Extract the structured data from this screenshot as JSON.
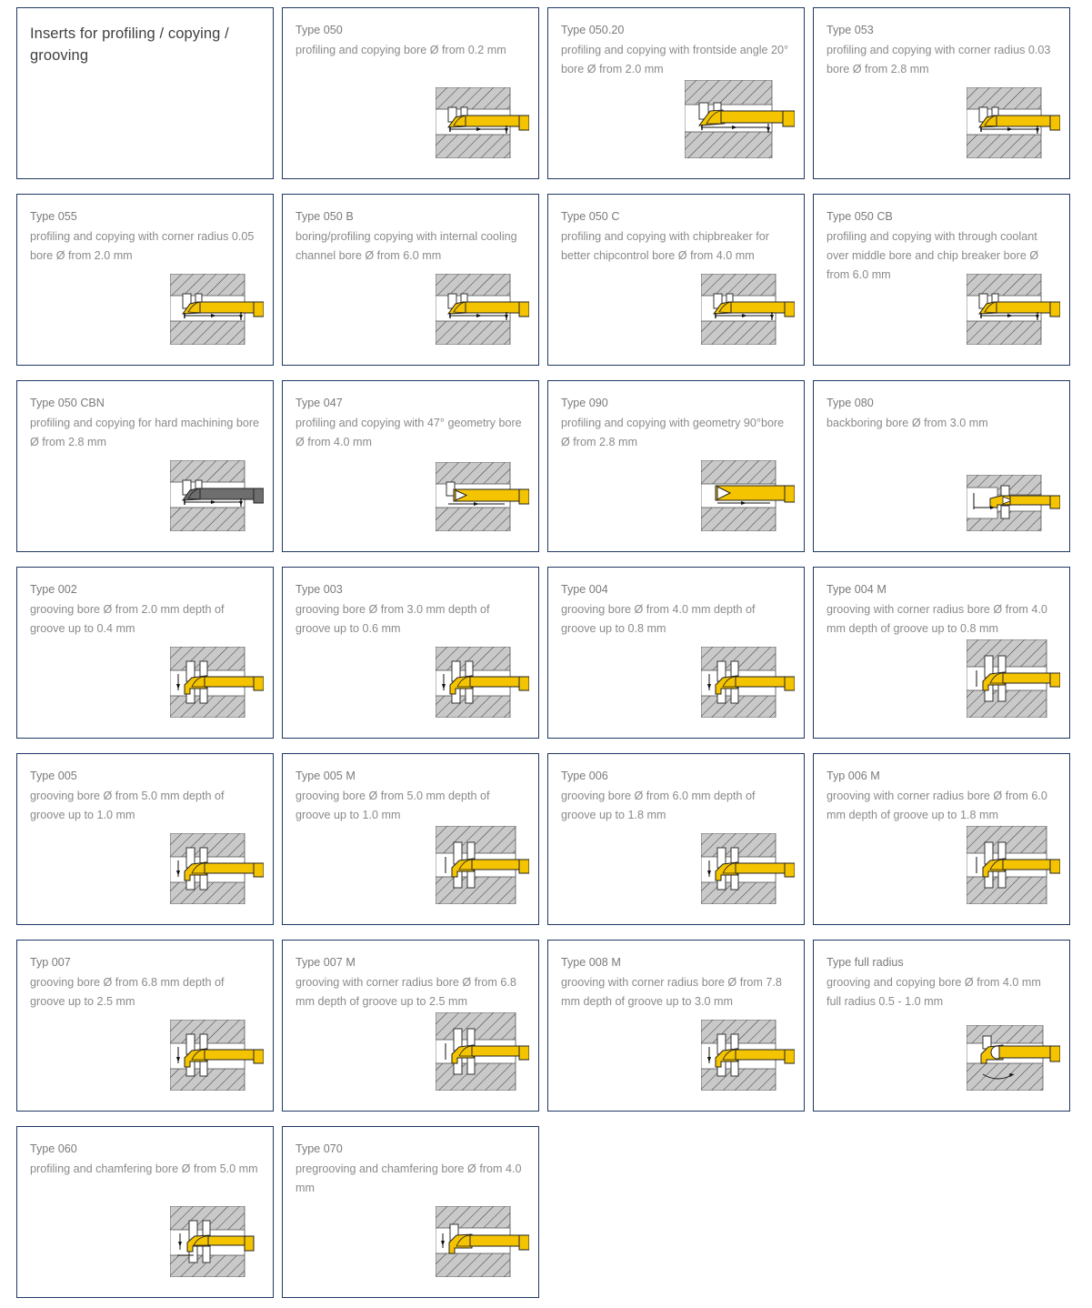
{
  "page": {
    "heading": "Inserts for profiling / copying / grooving",
    "border_color": "#1f3864",
    "text_color": "#808080",
    "tool_color": "#f5c400",
    "tool_color_cbn": "#6e6e6e",
    "material_color": "#c8c8c8"
  },
  "cards": [
    {
      "type": "Type 050",
      "description": "profiling and copying bore Ø from 0.2 mm",
      "figure": "boring-bar-straight"
    },
    {
      "type": "Type 050.20",
      "description": "profiling and copying with frontside angle 20° bore Ø from 2.0 mm",
      "figure": "boring-bar-angled"
    },
    {
      "type": "Type 053",
      "description": "profiling and copying with corner radius 0.03 bore Ø from 2.8 mm",
      "figure": "boring-bar-straight"
    },
    {
      "type": "Type 055",
      "description": "profiling and copying with corner radius 0.05 bore Ø from 2.0 mm",
      "figure": "boring-bar-straight"
    },
    {
      "type": "Type 050 B",
      "description": "boring/profiling copying with internal cooling channel bore Ø from 6.0 mm",
      "figure": "boring-bar-straight"
    },
    {
      "type": "Type 050 C",
      "description": "profiling and copying with chipbreaker for better chipcontrol bore Ø from 4.0 mm",
      "figure": "boring-bar-straight"
    },
    {
      "type": "Type 050 CB",
      "description": "profiling and copying with through coolant over middle bore and chip breaker bore Ø from 6.0 mm",
      "figure": "boring-bar-straight"
    },
    {
      "type": "Type 050 CBN",
      "description": "profiling and copying for hard machining bore Ø from 2.8 mm",
      "figure": "boring-bar-cbn"
    },
    {
      "type": "Type 047",
      "description": "profiling and copying with 47° geometry bore Ø from 4.0 mm",
      "figure": "boring-bar-47"
    },
    {
      "type": "Type 090",
      "description": "profiling and copying with geometry 90°bore Ø from 2.8 mm",
      "figure": "boring-bar-90"
    },
    {
      "type": "Type 080",
      "description": "backboring bore Ø from 3.0 mm",
      "figure": "backboring-bar"
    },
    {
      "type": "Type 002",
      "description": "grooving bore Ø from 2.0 mm depth of groove up to 0.4 mm",
      "figure": "grooving-bar"
    },
    {
      "type": "Type 003",
      "description": "grooving bore Ø from 3.0 mm depth of groove up to 0.6 mm",
      "figure": "grooving-bar"
    },
    {
      "type": "Type 004",
      "description": "grooving bore Ø from 4.0 mm depth of groove up to 0.8 mm",
      "figure": "grooving-bar"
    },
    {
      "type": "Type 004 M",
      "description": "grooving with corner radius bore Ø from 4.0 mm depth of groove up to 0.8 mm",
      "figure": "grooving-bar-m"
    },
    {
      "type": "Type 005",
      "description": "grooving bore Ø from 5.0 mm depth of groove up to 1.0 mm",
      "figure": "grooving-bar"
    },
    {
      "type": "Type 005 M",
      "description": "grooving bore Ø from 5.0 mm depth of groove up to 1.0 mm",
      "figure": "grooving-bar-m"
    },
    {
      "type": "Type 006",
      "description": "grooving bore Ø from 6.0 mm depth of groove up to 1.8 mm",
      "figure": "grooving-bar"
    },
    {
      "type": "Typ 006 M",
      "description": "grooving with corner radius bore Ø from 6.0 mm depth of groove up to 1.8 mm",
      "figure": "grooving-bar-m"
    },
    {
      "type": "Typ 007",
      "description": "grooving bore Ø from 6.8 mm depth of groove up to 2.5 mm",
      "figure": "grooving-bar"
    },
    {
      "type": "Type 007 M",
      "description": "grooving with corner radius bore Ø from 6.8 mm depth of groove up to 2.5 mm",
      "figure": "grooving-bar-m"
    },
    {
      "type": "Type 008 M",
      "description": "grooving with corner radius bore Ø from 7.8 mm depth of groove up to 3.0 mm",
      "figure": "grooving-bar"
    },
    {
      "type": "Type full radius",
      "description": "grooving and copying bore Ø from 4.0 mm full radius 0.5 - 1.0 mm",
      "figure": "full-radius-bar"
    },
    {
      "type": "Type 060",
      "description": "profiling and chamfering bore Ø from 5.0 mm",
      "figure": "chamfering-bar"
    },
    {
      "type": "Type 070",
      "description": "pregrooving and chamfering bore Ø from 4.0 mm",
      "figure": "pregrooving-bar"
    }
  ]
}
